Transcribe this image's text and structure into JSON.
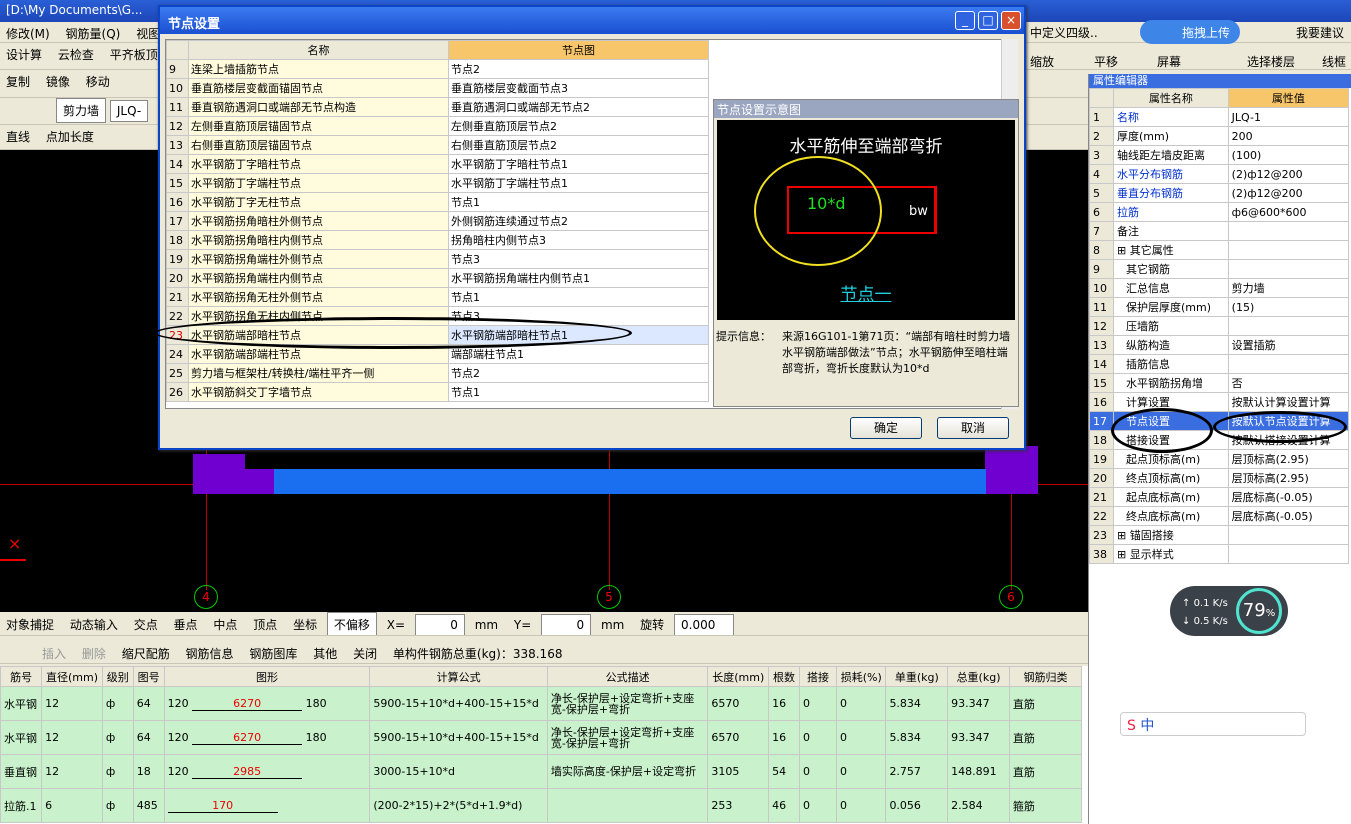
{
  "window_title": "[D:\\My Documents\\G...",
  "menu": [
    "修改(M)",
    "钢筋量(Q)",
    "视图"
  ],
  "toolbar1": [
    "设计算",
    "云检查",
    "平齐板顶"
  ],
  "toolbar2": [
    "复制",
    "镜像",
    "移动"
  ],
  "toolbar3": [
    "剪力墙",
    "JLQ-"
  ],
  "toolbar4": [
    "直线",
    "点加长度"
  ],
  "right_top": {
    "define": "中定义四级..",
    "upload": "拖拽上传",
    "suggest": "我要建议",
    "zoom": "缩放",
    "pan": "平移",
    "screen": "屏幕",
    "select_floor": "选择楼层",
    "wireframe": "线框"
  },
  "prop_panel": {
    "title": "属性编辑器",
    "col_name": "属性名称",
    "col_value": "属性值",
    "rows": [
      {
        "no": "1",
        "name": "名称",
        "value": "JLQ-1"
      },
      {
        "no": "2",
        "name": "厚度(mm)",
        "value": "200"
      },
      {
        "no": "3",
        "name": "轴线距左墙皮距离",
        "value": "(100)"
      },
      {
        "no": "4",
        "name": "水平分布钢筋",
        "value": "(2)ф12@200"
      },
      {
        "no": "5",
        "name": "垂直分布钢筋",
        "value": "(2)ф12@200"
      },
      {
        "no": "6",
        "name": "拉筋",
        "value": "ф6@600*600"
      },
      {
        "no": "7",
        "name": "备注",
        "value": ""
      },
      {
        "no": "8",
        "name": "其它属性",
        "value": ""
      },
      {
        "no": "9",
        "name": "其它钢筋",
        "value": ""
      },
      {
        "no": "10",
        "name": "汇总信息",
        "value": "剪力墙"
      },
      {
        "no": "11",
        "name": "保护层厚度(mm)",
        "value": "(15)"
      },
      {
        "no": "12",
        "name": "压墙筋",
        "value": ""
      },
      {
        "no": "13",
        "name": "纵筋构造",
        "value": "设置插筋"
      },
      {
        "no": "14",
        "name": "插筋信息",
        "value": ""
      },
      {
        "no": "15",
        "name": "水平钢筋拐角增",
        "value": "否"
      },
      {
        "no": "16",
        "name": "计算设置",
        "value": "按默认计算设置计算"
      },
      {
        "no": "17",
        "name": "节点设置",
        "value": "按默认节点设置计算"
      },
      {
        "no": "18",
        "name": "搭接设置",
        "value": "按默认搭接设置计算"
      },
      {
        "no": "19",
        "name": "起点顶标高(m)",
        "value": "层顶标高(2.95)"
      },
      {
        "no": "20",
        "name": "终点顶标高(m)",
        "value": "层顶标高(2.95)"
      },
      {
        "no": "21",
        "name": "起点底标高(m)",
        "value": "层底标高(-0.05)"
      },
      {
        "no": "22",
        "name": "终点底标高(m)",
        "value": "层底标高(-0.05)"
      },
      {
        "no": "23",
        "name": "锚固搭接",
        "value": ""
      },
      {
        "no": "38",
        "name": "显示样式",
        "value": ""
      }
    ]
  },
  "dialog": {
    "title": "节点设置",
    "col_name": "名称",
    "col_node": "节点图",
    "rows": [
      {
        "no": "9",
        "name": "连梁上墙插筋节点",
        "node": "节点2"
      },
      {
        "no": "10",
        "name": "垂直筋楼层变截面锚固节点",
        "node": "垂直筋楼层变截面节点3"
      },
      {
        "no": "11",
        "name": "垂直钢筋遇洞口或端部无节点构造",
        "node": "垂直筋遇洞口或端部无节点2"
      },
      {
        "no": "12",
        "name": "左侧垂直筋顶层锚固节点",
        "node": "左侧垂直筋顶层节点2"
      },
      {
        "no": "13",
        "name": "右侧垂直筋顶层锚固节点",
        "node": "右侧垂直筋顶层节点2"
      },
      {
        "no": "14",
        "name": "水平钢筋丁字暗柱节点",
        "node": "水平钢筋丁字暗柱节点1"
      },
      {
        "no": "15",
        "name": "水平钢筋丁字端柱节点",
        "node": "水平钢筋丁字端柱节点1"
      },
      {
        "no": "16",
        "name": "水平钢筋丁字无柱节点",
        "node": "节点1"
      },
      {
        "no": "17",
        "name": "水平钢筋拐角暗柱外侧节点",
        "node": "外侧钢筋连续通过节点2"
      },
      {
        "no": "18",
        "name": "水平钢筋拐角暗柱内侧节点",
        "node": "拐角暗柱内侧节点3"
      },
      {
        "no": "19",
        "name": "水平钢筋拐角端柱外侧节点",
        "node": "节点3"
      },
      {
        "no": "20",
        "name": "水平钢筋拐角端柱内侧节点",
        "node": "水平钢筋拐角端柱内侧节点1"
      },
      {
        "no": "21",
        "name": "水平钢筋拐角无柱外侧节点",
        "node": "节点1"
      },
      {
        "no": "22",
        "name": "水平钢筋拐角无柱内侧节点",
        "node": "节点3"
      },
      {
        "no": "23",
        "name": "水平钢筋端部暗柱节点",
        "node": "水平钢筋端部暗柱节点1"
      },
      {
        "no": "24",
        "name": "水平钢筋端部端柱节点",
        "node": "端部端柱节点1"
      },
      {
        "no": "25",
        "name": "剪力墙与框架柱/转换柱/端柱平齐一侧",
        "node": "节点2"
      },
      {
        "no": "26",
        "name": "水平钢筋斜交丁字墙节点",
        "node": "节点1"
      }
    ],
    "preview_title": "节点设置示意图",
    "preview_heading": "水平筋伸至端部弯折",
    "preview_label": "10*d",
    "preview_bw": "bw",
    "preview_node": "节点一",
    "tip_label": "提示信息：",
    "tip_text": "来源16G101-1第71页：“端部有暗柱时剪力墙水平钢筋端部做法”节点；水平钢筋伸至暗柱端部弯折，弯折长度默认为10*d",
    "ok": "确定",
    "cancel": "取消"
  },
  "axes": [
    "4",
    "5",
    "6"
  ],
  "snap_bar": {
    "items": [
      "对象捕捉",
      "动态输入",
      "交点",
      "垂点",
      "中点",
      "顶点",
      "坐标"
    ],
    "offset": "不偏移",
    "x_label": "X=",
    "x_val": "0",
    "y_label": "Y=",
    "y_val": "0",
    "mm": "mm",
    "rotate": "旋转",
    "rotate_val": "0.000"
  },
  "rebar_bar": {
    "items": [
      "插入",
      "删除",
      "缩尺配筋",
      "钢筋信息",
      "钢筋图库",
      "其他",
      "关闭"
    ],
    "total": "单构件钢筋总重(kg)：338.168"
  },
  "rebar_table": {
    "headers": [
      "筋号",
      "直径(mm)",
      "级别",
      "图号",
      "图形",
      "计算公式",
      "公式描述",
      "长度(mm)",
      "根数",
      "搭接",
      "损耗(%)",
      "单重(kg)",
      "总重(kg)",
      "钢筋归类"
    ],
    "rows": [
      {
        "name": "水平钢",
        "dia": "12",
        "grade": "ф",
        "fig": "64",
        "s1": "120",
        "s2": "6270",
        "s3": "180",
        "formula": "5900-15+10*d+400-15+15*d",
        "desc": "净长-保护层+设定弯折+支座宽-保护层+弯折",
        "len": "6570",
        "count": "16",
        "lap": "0",
        "loss": "0",
        "unit": "5.834",
        "total": "93.347",
        "cat": "直筋"
      },
      {
        "name": "水平钢",
        "dia": "12",
        "grade": "ф",
        "fig": "64",
        "s1": "120",
        "s2": "6270",
        "s3": "180",
        "formula": "5900-15+10*d+400-15+15*d",
        "desc": "净长-保护层+设定弯折+支座宽-保护层+弯折",
        "len": "6570",
        "count": "16",
        "lap": "0",
        "loss": "0",
        "unit": "5.834",
        "total": "93.347",
        "cat": "直筋"
      },
      {
        "name": "垂直钢",
        "dia": "12",
        "grade": "ф",
        "fig": "18",
        "s1": "120",
        "s2": "2985",
        "s3": "",
        "formula": "3000-15+10*d",
        "desc": "墙实际高度-保护层+设定弯折",
        "len": "3105",
        "count": "54",
        "lap": "0",
        "loss": "0",
        "unit": "2.757",
        "total": "148.891",
        "cat": "直筋"
      },
      {
        "name": "拉筋.1",
        "dia": "6",
        "grade": "ф",
        "fig": "485",
        "s1": "",
        "s2": "170",
        "s3": "",
        "formula": "(200-2*15)+2*(5*d+1.9*d)",
        "desc": "",
        "len": "253",
        "count": "46",
        "lap": "0",
        "loss": "0",
        "unit": "0.056",
        "total": "2.584",
        "cat": "箍筋"
      }
    ]
  },
  "net": {
    "up": "0.1",
    "down": "0.5",
    "unit": "K/s",
    "percent": "79",
    "pct_sign": "%"
  },
  "ime": "中"
}
